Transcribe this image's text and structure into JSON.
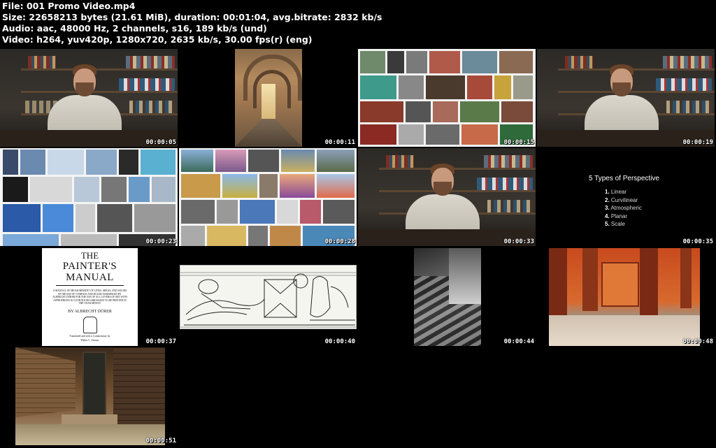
{
  "header": {
    "file_label": "File:",
    "file_value": "001 Promo Video.mp4",
    "size_label": "Size:",
    "size_value": "22658213 bytes (21.61 MiB), duration: 00:01:04, avg.bitrate: 2832 kb/s",
    "audio_label": "Audio:",
    "audio_value": "aac, 48000 Hz, 2 channels, s16, 189 kb/s (und)",
    "video_label": "Video:",
    "video_value": "h264, yuv420p, 1280x720, 2635 kb/s, 30.00 fps(r) (eng)"
  },
  "thumbnails": [
    {
      "timestamp": "00:00:05"
    },
    {
      "timestamp": "00:00:11"
    },
    {
      "timestamp": "00:00:15"
    },
    {
      "timestamp": "00:00:19"
    },
    {
      "timestamp": "00:00:23"
    },
    {
      "timestamp": "00:00:28"
    },
    {
      "timestamp": "00:00:33"
    },
    {
      "timestamp": "00:00:35"
    },
    {
      "timestamp": "00:00:37"
    },
    {
      "timestamp": "00:00:40"
    },
    {
      "timestamp": "00:00:44"
    },
    {
      "timestamp": "00:00:48"
    },
    {
      "timestamp": "00:00:51"
    }
  ],
  "slide": {
    "title": "5 Types of Perspective",
    "items": [
      {
        "num": "1.",
        "label": "Linear"
      },
      {
        "num": "2.",
        "label": "Curvilinear"
      },
      {
        "num": "3.",
        "label": "Atmospheric"
      },
      {
        "num": "4.",
        "label": "Planar"
      },
      {
        "num": "5.",
        "label": "Scale"
      }
    ]
  },
  "book": {
    "title_line1": "THE",
    "title_line2": "PAINTER'S MANUAL",
    "description": "A MANUAL OF MEASUREMENT OF LINES, AREAS, AND SOLIDS BY MEANS OF COMPASS AND RULER ASSEMBLED BY ALBRECHT DÜRER FOR THE USE OF ALL LOVERS OF ART WITH APPROPRIATE ILLUSTRATIONS ARRANGED TO BE PRINTED IN THE YEAR MDXXV",
    "author": "BY ALBRECHT DÜRER",
    "translator": "Translated and with a Commentary by",
    "translator_name": "Walter L. Strauss"
  },
  "colors": {
    "background": "#000000",
    "text": "#ffffff"
  }
}
